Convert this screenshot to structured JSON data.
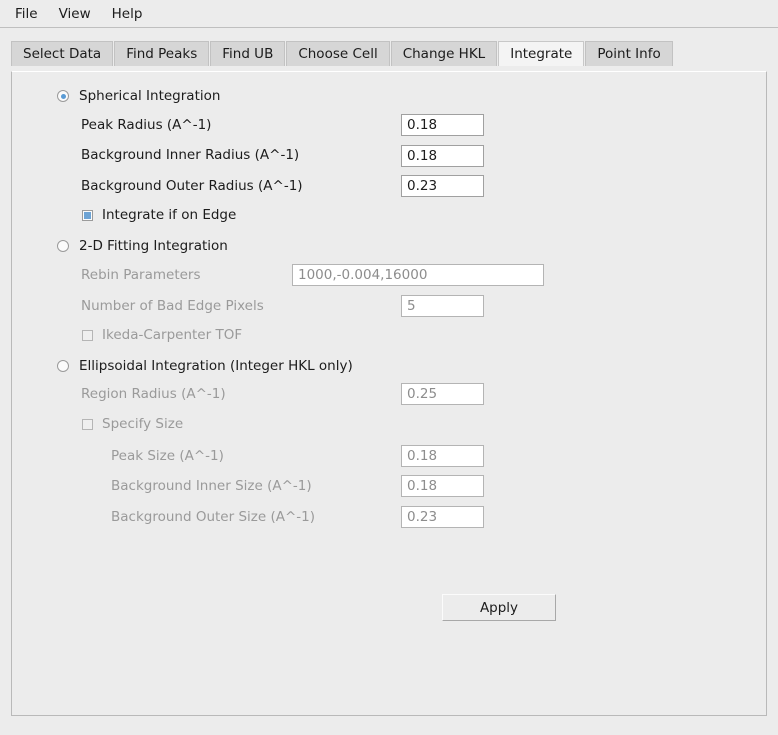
{
  "menubar": {
    "items": [
      {
        "label": "File"
      },
      {
        "label": "View"
      },
      {
        "label": "Help"
      }
    ]
  },
  "tabs": [
    {
      "label": "Select Data",
      "selected": false
    },
    {
      "label": "Find Peaks",
      "selected": false
    },
    {
      "label": "Find UB",
      "selected": false
    },
    {
      "label": "Choose Cell",
      "selected": false
    },
    {
      "label": "Change HKL",
      "selected": false
    },
    {
      "label": "Integrate",
      "selected": true
    },
    {
      "label": "Point Info",
      "selected": false
    }
  ],
  "integrate": {
    "spherical": {
      "radio_label": "Spherical Integration",
      "selected": true,
      "enabled": true,
      "fields": [
        {
          "label": "Peak Radius (A^-1)",
          "value": "0.18"
        },
        {
          "label": "Background Inner Radius (A^-1)",
          "value": "0.18"
        },
        {
          "label": "Background Outer Radius (A^-1)",
          "value": "0.23"
        }
      ],
      "checkbox": {
        "label": "Integrate if on Edge",
        "checked": true
      }
    },
    "fitting2d": {
      "radio_label": "2-D Fitting Integration",
      "selected": false,
      "enabled": false,
      "fields": [
        {
          "label": "Rebin Parameters",
          "value": "1000,-0.004,16000"
        },
        {
          "label": "Number of Bad Edge Pixels",
          "value": "5"
        }
      ],
      "checkbox": {
        "label": "Ikeda-Carpenter TOF",
        "checked": false
      }
    },
    "ellipsoidal": {
      "radio_label": "Ellipsoidal Integration (Integer HKL only)",
      "selected": false,
      "enabled": false,
      "fields": [
        {
          "label": "Region Radius (A^-1)",
          "value": "0.25"
        }
      ],
      "checkbox": {
        "label": "Specify Size",
        "checked": false
      },
      "size_fields": [
        {
          "label": "Peak Size (A^-1)",
          "value": "0.18"
        },
        {
          "label": "Background Inner Size (A^-1)",
          "value": "0.18"
        },
        {
          "label": "Background Outer Size (A^-1)",
          "value": "0.23"
        }
      ]
    },
    "apply_label": "Apply"
  },
  "colors": {
    "background": "#ececec",
    "accent": "#5a9bd5",
    "disabled_text": "#9a9a9a",
    "text": "#1c1c1c"
  }
}
